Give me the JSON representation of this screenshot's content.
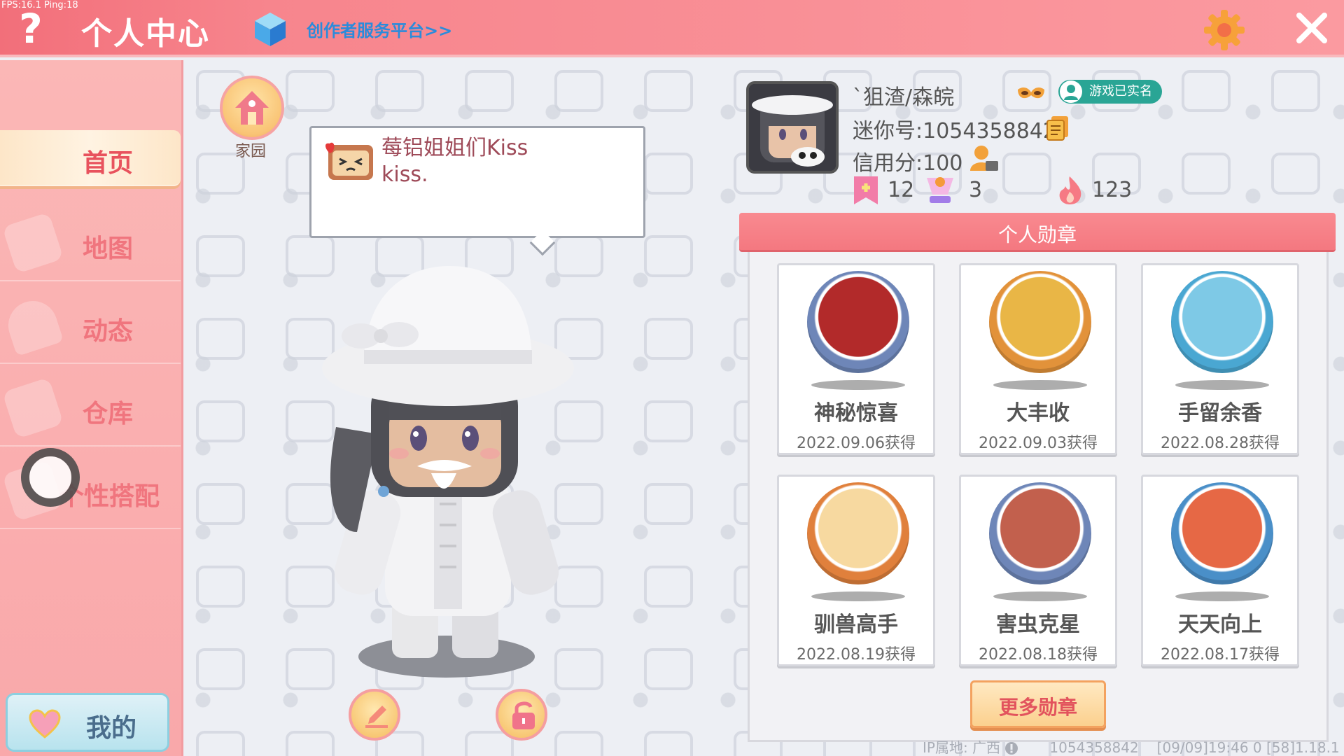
{
  "debug": {
    "fps_text": "FPS:16.1  Ping:18"
  },
  "topbar": {
    "help_symbol": "?",
    "title": "个人中心",
    "creator_link": "创作者服务平台>>",
    "settings_icon": "gear-icon",
    "close_icon": "close-icon"
  },
  "sidebar": {
    "items": [
      {
        "label": "首页",
        "active": true
      },
      {
        "label": "地图",
        "active": false
      },
      {
        "label": "动态",
        "active": false
      },
      {
        "label": "仓库",
        "active": false
      },
      {
        "label": "个性搭配",
        "active": false
      }
    ],
    "my_button": "我的"
  },
  "home": {
    "label": "家园"
  },
  "bubble": {
    "text": "莓铝姐姐们Kiss\nkiss."
  },
  "profile": {
    "nickname": "`狙渣/森皖",
    "verified": "游戏已实名",
    "mini_id": "迷你号:1054358842",
    "credit": "信用分:100",
    "stats": [
      {
        "icon": "flag-icon",
        "value": "12"
      },
      {
        "icon": "trophy-icon",
        "value": "3"
      },
      {
        "icon": "flame-icon",
        "value": "123"
      }
    ]
  },
  "medals": {
    "header": "个人勋章",
    "items": [
      {
        "name": "神秘惊喜",
        "date": "2022.09.06获得",
        "color": "#b22a2a",
        "ring": "#6e86b8"
      },
      {
        "name": "大丰收",
        "date": "2022.09.03获得",
        "color": "#e9b646",
        "ring": "#e2923a"
      },
      {
        "name": "手留余香",
        "date": "2022.08.28获得",
        "color": "#7ec9e6",
        "ring": "#4aa7d2"
      },
      {
        "name": "驯兽高手",
        "date": "2022.08.19获得",
        "color": "#f7d9a0",
        "ring": "#e0803c"
      },
      {
        "name": "害虫克星",
        "date": "2022.08.18获得",
        "color": "#c2604d",
        "ring": "#6e86b8"
      },
      {
        "name": "天天向上",
        "date": "2022.08.17获得",
        "color": "#e66845",
        "ring": "#4a8fc8"
      }
    ],
    "more_button": "更多勋章"
  },
  "footer": {
    "ip_text": "IP属地: 广西",
    "info_icon": "info-icon",
    "id_text": "1054358842",
    "time_text": "[09/09]19:46 0  [58]1.18.1"
  },
  "colors": {
    "topbar": "#f7858d",
    "sidebar": "#fbb7b6",
    "accent": "#f47880",
    "creator_link": "#2b8bdb",
    "verified": "#2aa595"
  }
}
